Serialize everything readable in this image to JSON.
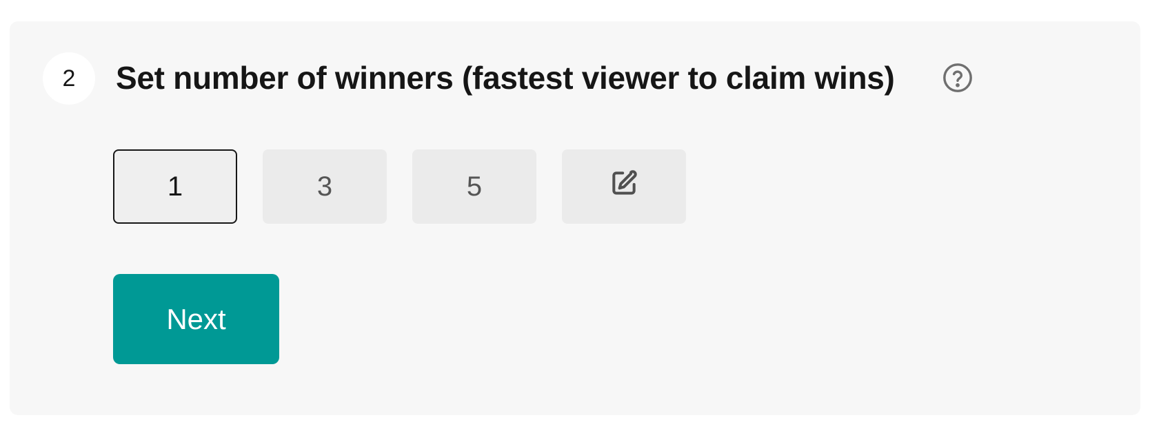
{
  "step": {
    "number": "2",
    "title": "Set number of winners (fastest viewer to claim wins)",
    "help_icon": "question-circle-icon"
  },
  "winner_options": [
    {
      "label": "1",
      "selected": true
    },
    {
      "label": "3",
      "selected": false
    },
    {
      "label": "5",
      "selected": false
    },
    {
      "label": "",
      "icon": "edit-icon",
      "selected": false
    }
  ],
  "actions": {
    "next_label": "Next"
  },
  "colors": {
    "card_bg": "#f7f7f7",
    "option_bg": "#ebebeb",
    "accent": "#009995",
    "text": "#161616"
  }
}
